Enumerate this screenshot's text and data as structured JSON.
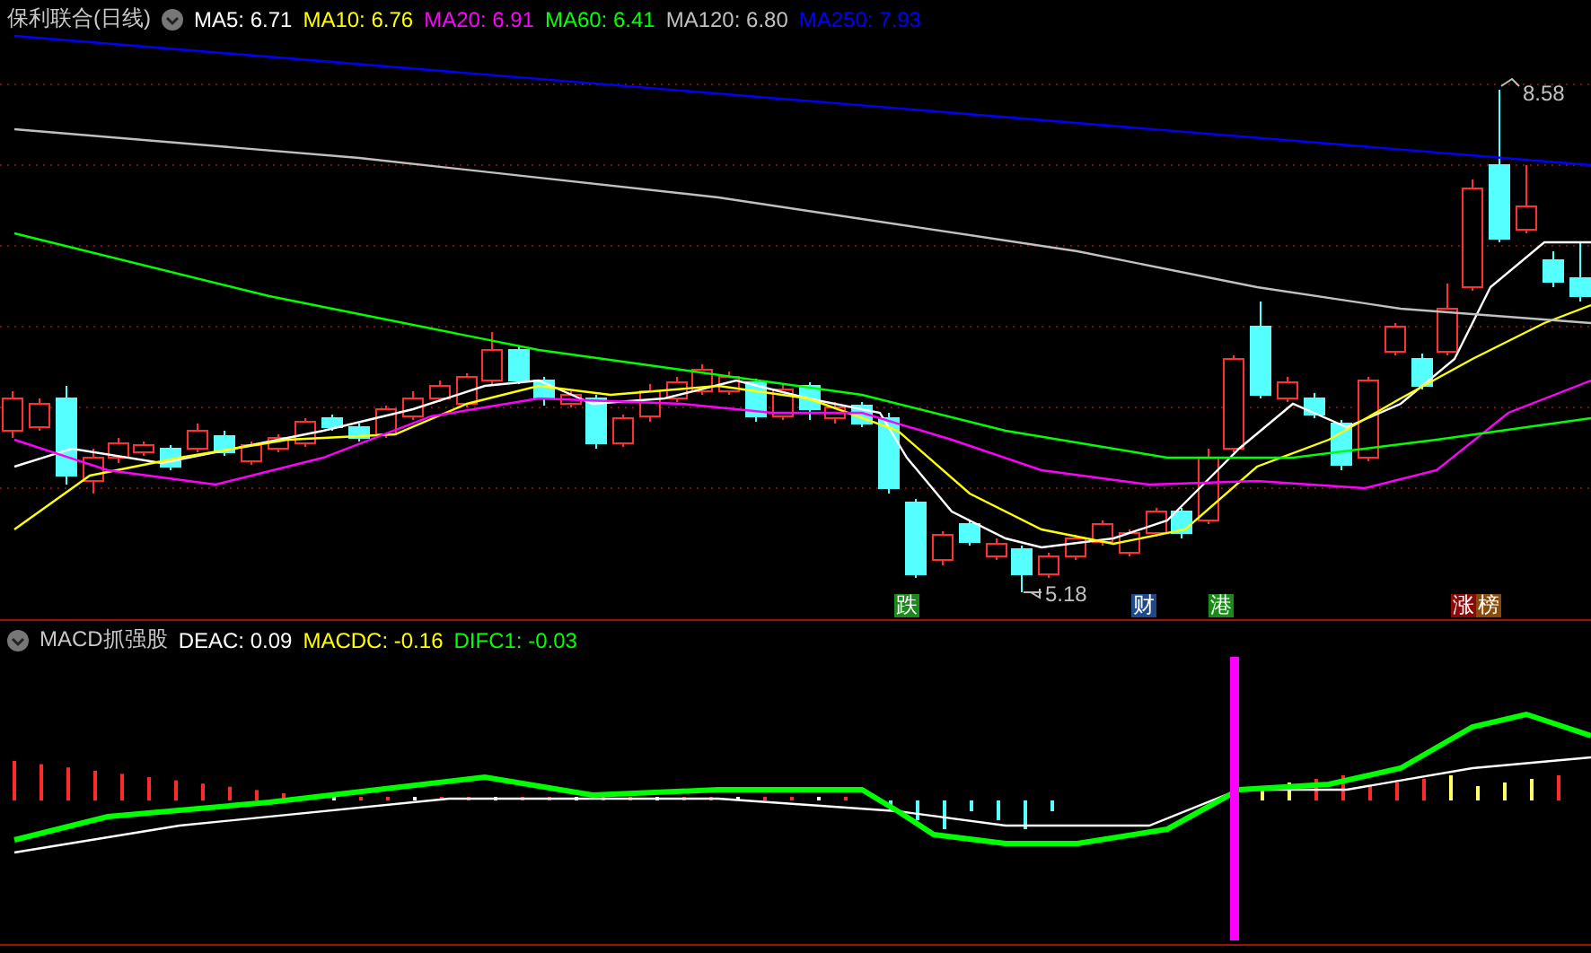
{
  "main_chart": {
    "title": "保利联合(日线)",
    "legend": [
      {
        "label": "MA5: 6.71",
        "color": "#ffffff"
      },
      {
        "label": "MA10: 6.76",
        "color": "#ffff00"
      },
      {
        "label": "MA20: 6.91",
        "color": "#ff00ff"
      },
      {
        "label": "MA60: 6.41",
        "color": "#00ff00"
      },
      {
        "label": "MA120: 6.80",
        "color": "#c0c0c0"
      },
      {
        "label": "MA250: 7.93",
        "color": "#0000ff"
      }
    ],
    "high_label": "8.58",
    "low_label": "5.18",
    "signals": [
      {
        "label": "跌",
        "color": "#1a8a1a"
      },
      {
        "label": "财",
        "color": "#1e4a8a"
      },
      {
        "label": "港",
        "color": "#1a8a1a"
      },
      {
        "label": "涨",
        "color": "#8a0a0a"
      },
      {
        "label": "榜",
        "color": "#8a4a0a"
      }
    ]
  },
  "indicator": {
    "title": "MACD抓强股",
    "legend": [
      {
        "label": "DEAC: 0.09",
        "color": "#ffffff"
      },
      {
        "label": "MACDC: -0.16",
        "color": "#ffff00"
      },
      {
        "label": "DIFC1: -0.03",
        "color": "#00ff00"
      }
    ]
  }
}
